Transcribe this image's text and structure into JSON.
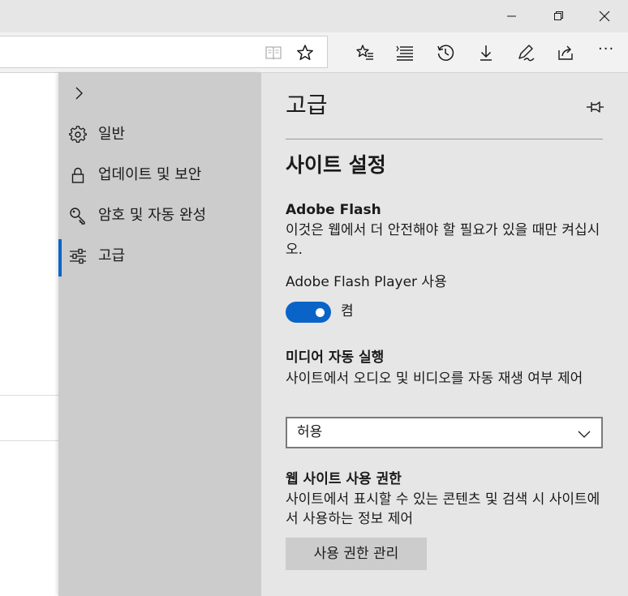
{
  "window": {
    "controls": [
      "minimize",
      "maximize",
      "close"
    ]
  },
  "toolbar": {
    "icons": [
      "reading-view-icon",
      "favorite-star-icon",
      "favorites-hub-icon",
      "reading-list-icon",
      "history-icon",
      "downloads-icon",
      "pen-icon",
      "share-icon",
      "more-icon"
    ],
    "more_label": "···"
  },
  "nav": {
    "items": [
      {
        "label": "일반",
        "icon": "gear-icon"
      },
      {
        "label": "업데이트 및 보안",
        "icon": "lock-icon"
      },
      {
        "label": "암호 및 자동 완성",
        "icon": "key-icon"
      },
      {
        "label": "고급",
        "icon": "sliders-icon",
        "active": true
      }
    ]
  },
  "panel": {
    "title": "고급",
    "section_title": "사이트 설정",
    "flash": {
      "title": "Adobe Flash",
      "description": "이것은 웹에서 더 안전해야 할 필요가 있을 때만 켜십시오.",
      "toggle_label": "Adobe Flash Player 사용",
      "toggle_state": "켬",
      "toggle_on": true
    },
    "autoplay": {
      "title": "미디어 자동 실행",
      "description": "사이트에서 오디오 및 비디오를 자동 재생 여부 제어",
      "selected": "허용"
    },
    "permissions": {
      "title": "웹 사이트 사용 권한",
      "description": "사이트에서 표시할 수 있는 콘텐츠 및 검색 시 사이트에서 사용하는 정보 제어",
      "button_label": "사용 권한 관리"
    }
  },
  "colors": {
    "accent": "#0a64c8",
    "nav_bg": "#cccccc",
    "panel_bg": "#e6e6e6",
    "titlebar_bg": "#e6e6e6",
    "toolbar_bg": "#f2f2f2"
  }
}
